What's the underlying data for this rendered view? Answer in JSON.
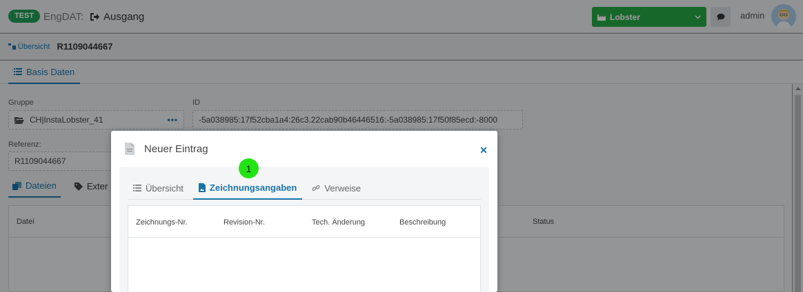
{
  "header": {
    "env_badge": "TEST",
    "app_name": "EngDAT:",
    "section": "Ausgang",
    "system_select": "Lobster",
    "user": "admin"
  },
  "breadcrumb": {
    "link": "Übersicht",
    "current": "R1109044667"
  },
  "main_tabs": [
    {
      "label": "Basis Daten",
      "active": true
    }
  ],
  "form": {
    "gruppe_label": "Gruppe",
    "gruppe_value": "CH|InstaLobster_41",
    "id_label": "ID",
    "id_value": "-5a038985:17f52cba1a4:26c3.22cab90b46446516:-5a038985:17f50f85ecd:-8000",
    "referenz_label": "Referenz:",
    "referenz_value": "R1109044667"
  },
  "sub_tabs": [
    {
      "label": "Dateien",
      "active": true
    },
    {
      "label": "Exter",
      "active": false
    }
  ],
  "files_table": {
    "columns": [
      "Datei",
      "Status"
    ]
  },
  "modal": {
    "title": "Neuer Eintrag",
    "tabs": [
      {
        "label": "Übersicht",
        "active": false
      },
      {
        "label": "Zeichnungsangaben",
        "active": true
      },
      {
        "label": "Verweise",
        "active": false
      }
    ],
    "table_columns": [
      "Zeichnungs-Nr.",
      "Revision-Nr.",
      "Tech. Änderung",
      "Beschreibung"
    ]
  },
  "step_marker": "1",
  "colors": {
    "accent": "#1a73a8",
    "success": "#28a745",
    "marker": "#22e414"
  }
}
